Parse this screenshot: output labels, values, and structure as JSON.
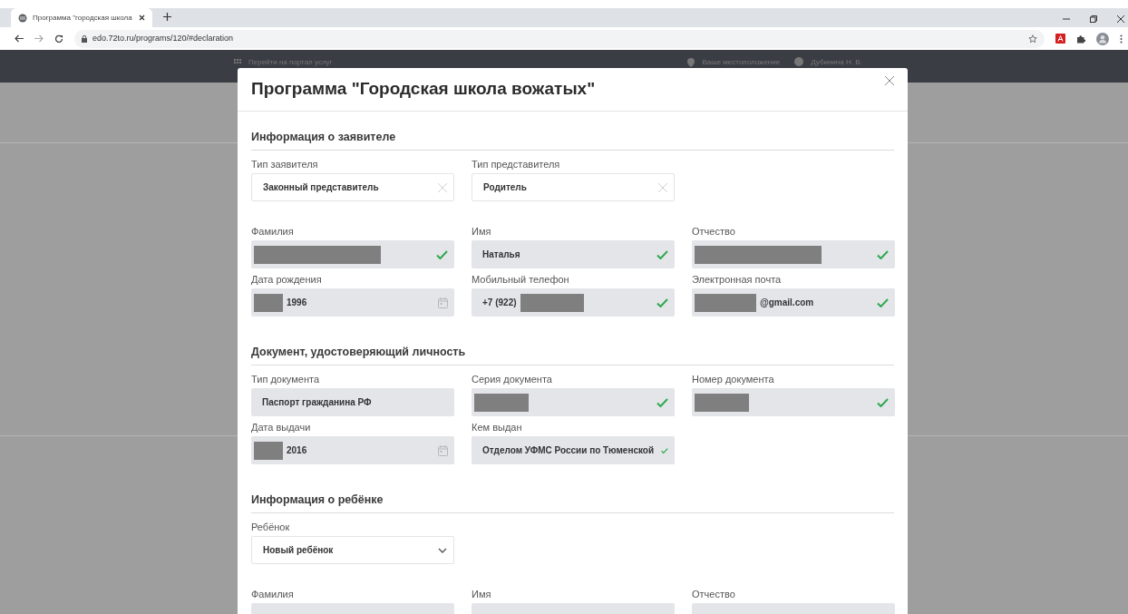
{
  "browser": {
    "tab_title": "Программа \"городская школа",
    "url": "edo.72to.ru/programs/120/#declaration"
  },
  "header": {
    "portal_link": "Перейти на портал услуг",
    "location": "Ваше местоположение",
    "user": "Дубинина Н. В."
  },
  "modal": {
    "title": "Программа \"Городская школа вожатых\"",
    "sections": [
      {
        "title": "Информация о заявителе",
        "rows": [
          [
            {
              "label": "Тип заявителя",
              "parts": [
                {
                  "kind": "text",
                  "value": "Законный представитель"
                }
              ],
              "kind": "clearable",
              "filled": false,
              "valid": false
            },
            {
              "label": "Тип представителя",
              "parts": [
                {
                  "kind": "text",
                  "value": "Родитель"
                }
              ],
              "kind": "clearable",
              "filled": false,
              "valid": false
            }
          ],
          [
            {
              "label": "Фамилия",
              "parts": [
                {
                  "kind": "redacted"
                }
              ],
              "kind": "text",
              "filled": true,
              "valid": true
            },
            {
              "label": "Имя",
              "parts": [
                {
                  "kind": "text",
                  "value": "Наталья"
                }
              ],
              "kind": "text",
              "filled": true,
              "valid": true
            },
            {
              "label": "Отчество",
              "parts": [
                {
                  "kind": "redacted"
                }
              ],
              "kind": "text",
              "filled": true,
              "valid": true
            }
          ],
          [
            {
              "label": "Дата рождения",
              "parts": [
                {
                  "kind": "redacted"
                },
                {
                  "kind": "text",
                  "value": "1996"
                }
              ],
              "kind": "date",
              "filled": true,
              "valid": false
            },
            {
              "label": "Мобильный телефон",
              "parts": [
                {
                  "kind": "text",
                  "value": "+7 (922)"
                },
                {
                  "kind": "redacted"
                }
              ],
              "kind": "text",
              "filled": true,
              "valid": true
            },
            {
              "label": "Электронная почта",
              "parts": [
                {
                  "kind": "redacted"
                },
                {
                  "kind": "text",
                  "value": "@gmail.com"
                }
              ],
              "kind": "text",
              "filled": true,
              "valid": true
            }
          ]
        ]
      },
      {
        "title": "Документ, удостоверяющий личность",
        "rows": [
          [
            {
              "label": "Тип документа",
              "parts": [
                {
                  "kind": "text",
                  "value": "Паспорт гражданина РФ"
                }
              ],
              "kind": "text",
              "filled": true,
              "valid": false
            },
            {
              "label": "Серия документа",
              "parts": [
                {
                  "kind": "redacted"
                }
              ],
              "kind": "text",
              "filled": true,
              "valid": true
            },
            {
              "label": "Номер документа",
              "parts": [
                {
                  "kind": "redacted"
                }
              ],
              "kind": "text",
              "filled": true,
              "valid": true
            }
          ],
          [
            {
              "label": "Дата выдачи",
              "parts": [
                {
                  "kind": "redacted"
                },
                {
                  "kind": "text",
                  "value": "2016"
                }
              ],
              "kind": "date",
              "filled": true,
              "valid": false
            },
            {
              "label": "Кем выдан",
              "parts": [
                {
                  "kind": "text",
                  "value": "Отделом УФМС России по Тюменской"
                }
              ],
              "kind": "text",
              "filled": true,
              "valid": true
            }
          ]
        ]
      },
      {
        "title": "Информация о ребёнке",
        "rows": [
          [
            {
              "label": "Ребёнок",
              "parts": [
                {
                  "kind": "text",
                  "value": "Новый ребёнок"
                }
              ],
              "kind": "dropdown",
              "filled": false,
              "valid": false
            }
          ],
          [
            {
              "label": "Фамилия",
              "kind": "text",
              "filled": true,
              "valid": false
            },
            {
              "label": "Имя",
              "kind": "text",
              "filled": true,
              "valid": false
            },
            {
              "label": "Отчество",
              "kind": "text",
              "filled": true,
              "valid": false
            }
          ]
        ]
      }
    ]
  }
}
